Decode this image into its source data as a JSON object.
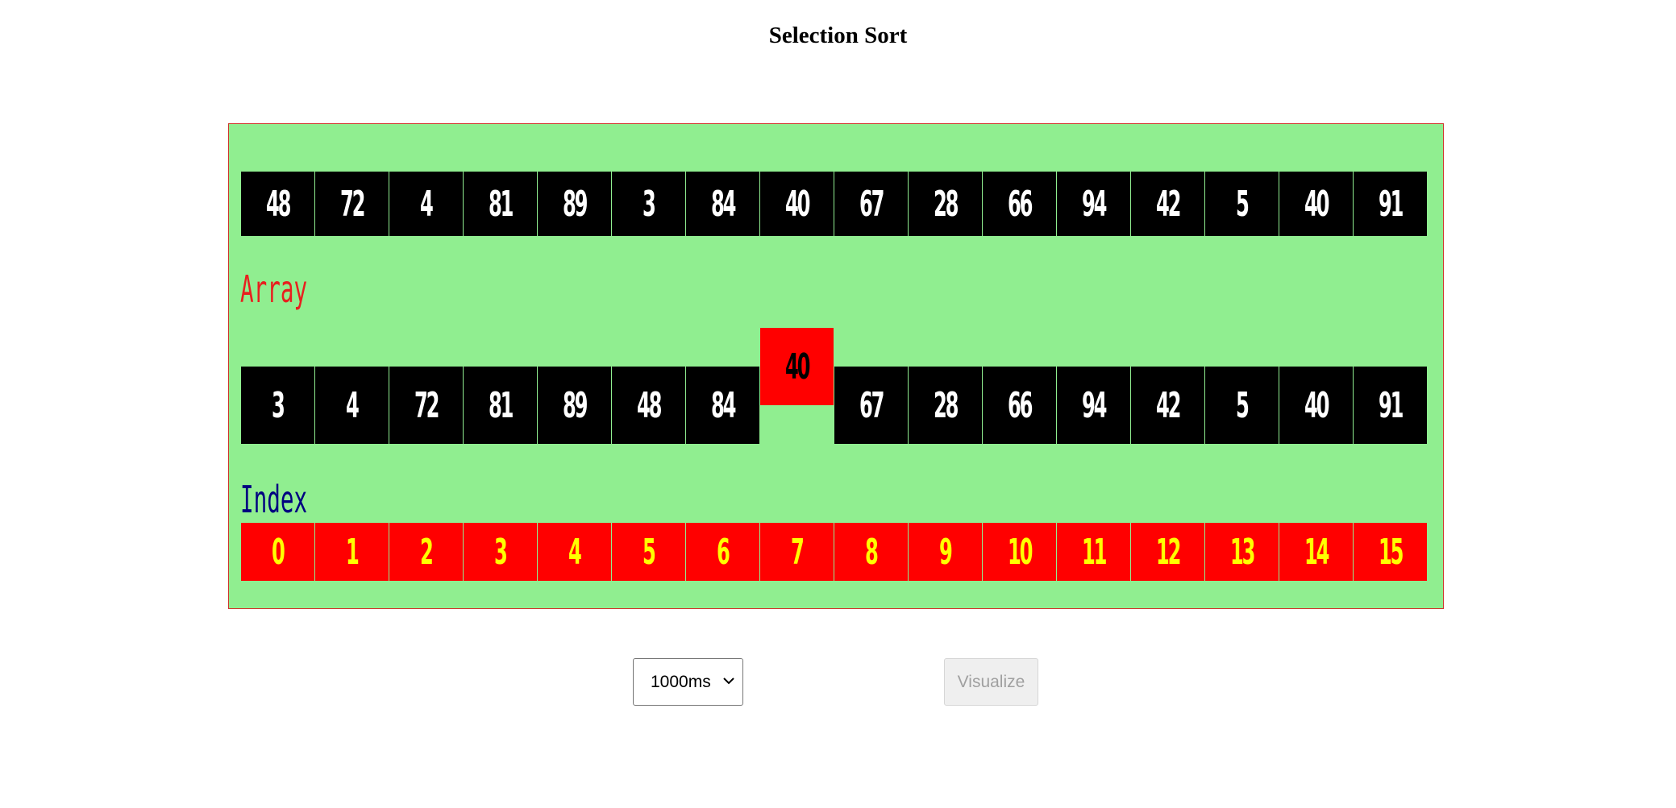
{
  "title": "Selection Sort",
  "labels": {
    "array": "Array",
    "index": "Index"
  },
  "top_row": [
    "48",
    "72",
    "4",
    "81",
    "89",
    "3",
    "84",
    "40",
    "67",
    "28",
    "66",
    "94",
    "42",
    "5",
    "40",
    "91"
  ],
  "middle_row": [
    "3",
    "4",
    "72",
    "81",
    "89",
    "48",
    "84",
    "40",
    "67",
    "28",
    "66",
    "94",
    "42",
    "5",
    "40",
    "91"
  ],
  "highlighted_index": 7,
  "index_row": [
    "0",
    "1",
    "2",
    "3",
    "4",
    "5",
    "6",
    "7",
    "8",
    "9",
    "10",
    "11",
    "12",
    "13",
    "14",
    "15"
  ],
  "controls": {
    "speed_value": "1000ms",
    "visualize_label": "Visualize",
    "visualize_enabled": false
  },
  "colors": {
    "panel_bg": "#90ee90",
    "cell_bg": "#000000",
    "highlight_bg": "#ff0000",
    "index_bg": "#ff0000",
    "index_text": "#ffff00"
  }
}
